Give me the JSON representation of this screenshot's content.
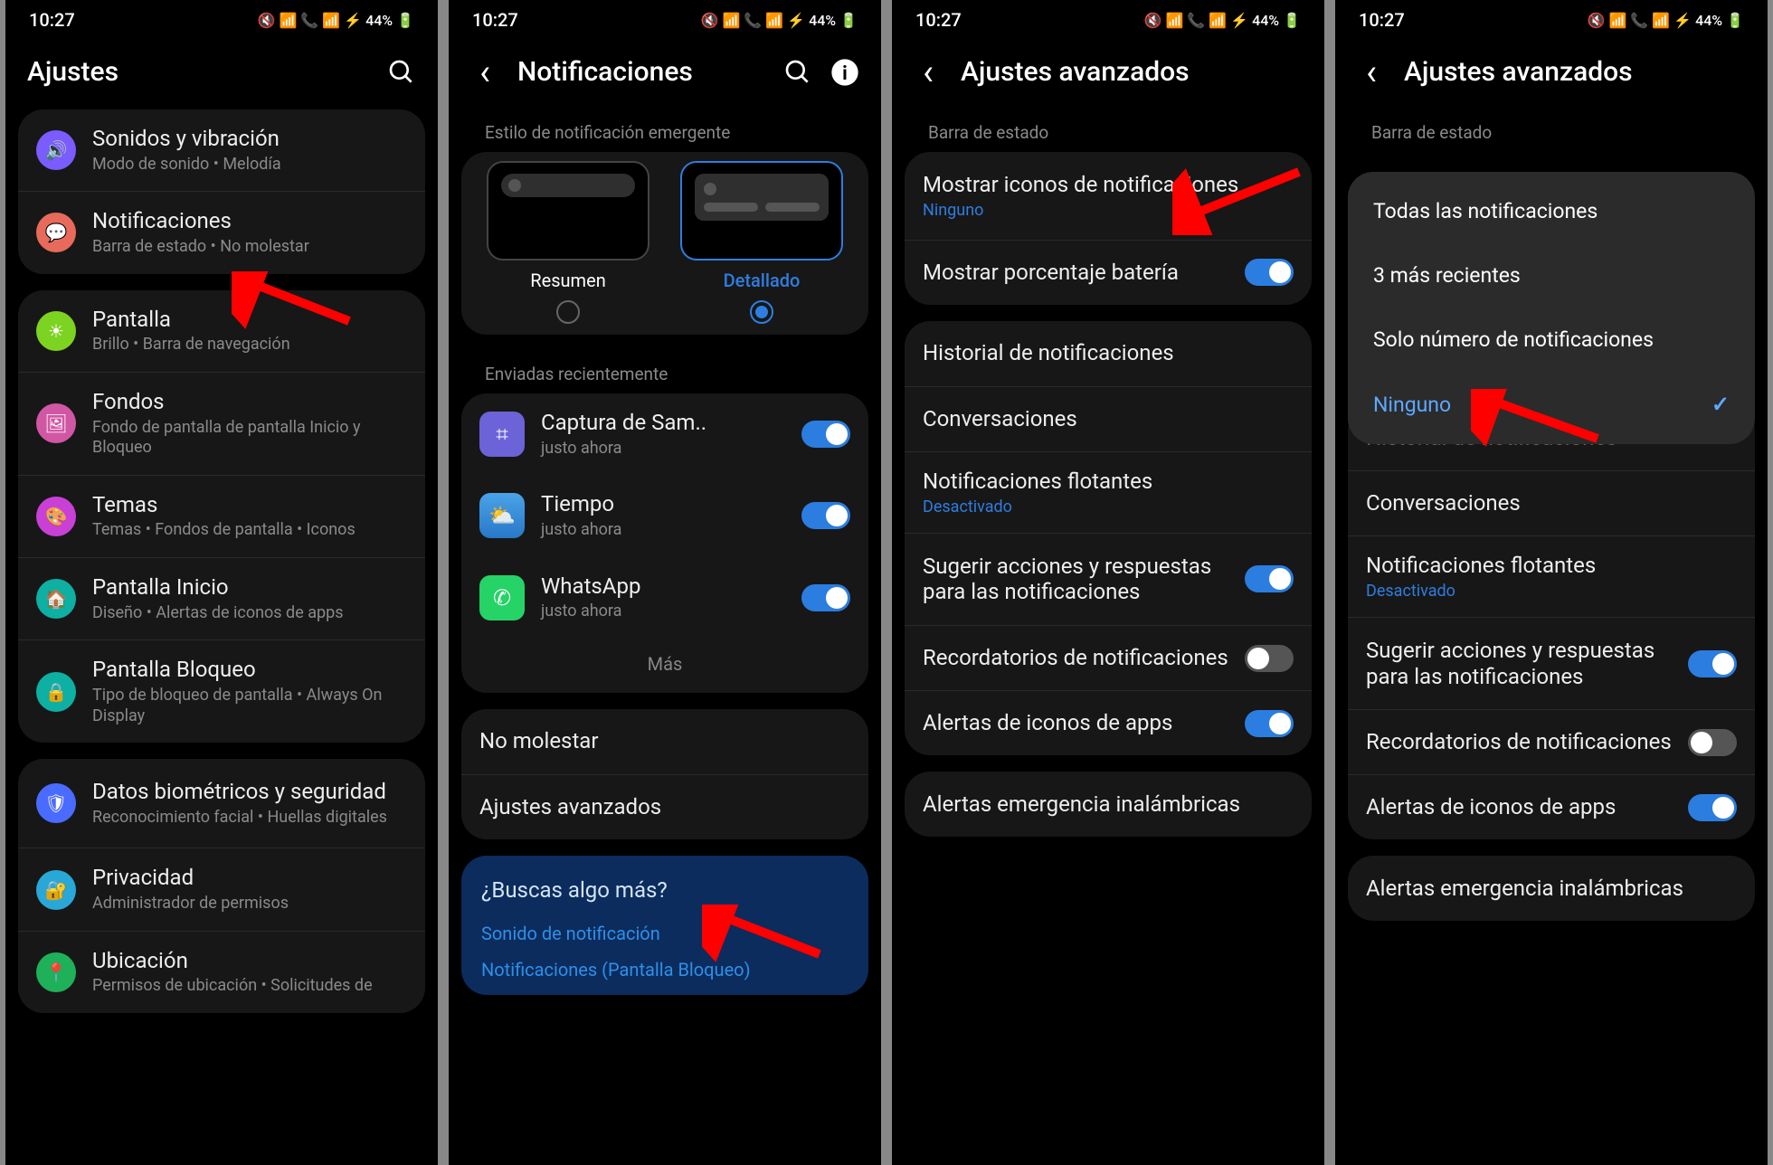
{
  "status": {
    "time": "10:27",
    "battery": "44%",
    "icons": "🔇 📶 📞 📶 ⚡"
  },
  "s1": {
    "title": "Ajustes",
    "items": [
      {
        "icon": "🔊",
        "cls": "ic-purple",
        "title": "Sonidos y vibración",
        "sub": "Modo de sonido  •  Melodía"
      },
      {
        "icon": "💬",
        "cls": "ic-salmon",
        "title": "Notificaciones",
        "sub": "Barra de estado  •  No molestar"
      },
      {
        "icon": "☀",
        "cls": "ic-lime",
        "title": "Pantalla",
        "sub": "Brillo  •  Barra de navegación"
      },
      {
        "icon": "🖼",
        "cls": "ic-pink",
        "title": "Fondos",
        "sub": "Fondo de pantalla de pantalla Inicio y Bloqueo"
      },
      {
        "icon": "🎨",
        "cls": "ic-mag",
        "title": "Temas",
        "sub": "Temas  •  Fondos de pantalla  •  Iconos"
      },
      {
        "icon": "🏠",
        "cls": "ic-teal",
        "title": "Pantalla Inicio",
        "sub": "Diseño  •  Alertas de iconos de apps"
      },
      {
        "icon": "🔒",
        "cls": "ic-teal2",
        "title": "Pantalla Bloqueo",
        "sub": "Tipo de bloqueo de pantalla  •  Always On Display"
      },
      {
        "icon": "🛡",
        "cls": "ic-blue",
        "title": "Datos biométricos y seguridad",
        "sub": "Reconocimiento facial  •  Huellas digitales"
      },
      {
        "icon": "🔐",
        "cls": "ic-cyan",
        "title": "Privacidad",
        "sub": "Administrador de permisos"
      },
      {
        "icon": "📍",
        "cls": "ic-green2",
        "title": "Ubicación",
        "sub": "Permisos de ubicación  •  Solicitudes de"
      }
    ]
  },
  "s2": {
    "title": "Notificaciones",
    "styleLabel": "Estilo de notificación emergente",
    "opt1": "Resumen",
    "opt2": "Detallado",
    "recentLabel": "Enviadas recientemente",
    "apps": [
      {
        "name": "Captura de Sam..",
        "sub": "justo ahora",
        "cls": "sq-purple",
        "sym": "⌗"
      },
      {
        "name": "Tiempo",
        "sub": "justo ahora",
        "cls": "sq-wx",
        "sym": "⛅"
      },
      {
        "name": "WhatsApp",
        "sub": "justo ahora",
        "cls": "sq-wa",
        "sym": "✆"
      }
    ],
    "mas": "Más",
    "noMolestar": "No molestar",
    "ajustesAv": "Ajustes avanzados",
    "helpTitle": "¿Buscas algo más?",
    "help1": "Sonido de notificación",
    "help2": "Notificaciones (Pantalla Bloqueo)"
  },
  "s3": {
    "title": "Ajustes avanzados",
    "barra": "Barra de estado",
    "mostrarIconos": "Mostrar iconos de notificaciones",
    "ninguno": "Ninguno",
    "mostrarBat": "Mostrar porcentaje batería",
    "historial": "Historial de notificaciones",
    "convers": "Conversaciones",
    "flotantes": "Notificaciones flotantes",
    "desact": "Desactivado",
    "sugerir": "Sugerir acciones y respuestas para las notificaciones",
    "recordat": "Recordatorios de notificaciones",
    "alertasIconos": "Alertas de iconos de apps",
    "alertasEmerg": "Alertas emergencia inalámbricas"
  },
  "s4": {
    "popup": {
      "o1": "Todas las notificaciones",
      "o2": "3 más recientes",
      "o3": "Solo número de notificaciones",
      "o4": "Ninguno"
    }
  }
}
